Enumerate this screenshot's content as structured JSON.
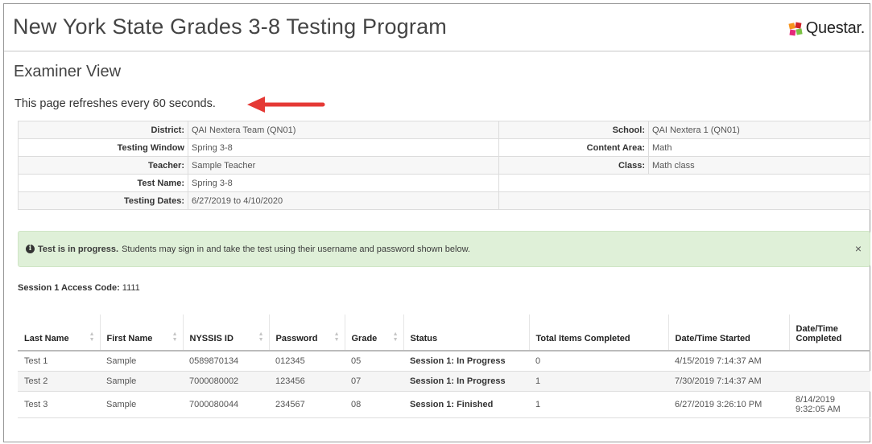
{
  "header": {
    "title": "New York State Grades 3-8 Testing Program",
    "logo_text": "Questar."
  },
  "page": {
    "subtitle": "Examiner View",
    "refresh_notice": "This page refreshes every 60 seconds."
  },
  "info": {
    "district_label": "District:",
    "district": "QAI Nextera Team (QN01)",
    "school_label": "School:",
    "school": "QAI Nextera 1 (QN01)",
    "window_label": "Testing Window",
    "window": "Spring 3-8",
    "content_label": "Content Area:",
    "content": "Math",
    "teacher_label": "Teacher:",
    "teacher": "Sample Teacher",
    "class_label": "Class:",
    "class": "Math class",
    "testname_label": "Test Name:",
    "testname": "Spring 3-8",
    "dates_label": "Testing Dates:",
    "dates": "6/27/2019 to 4/10/2020"
  },
  "alert": {
    "bold": "Test is in progress.",
    "text": "Students may sign in and take the test using their username and password shown below.",
    "close": "×"
  },
  "access": {
    "label": "Session 1 Access Code:",
    "code": "1111"
  },
  "roster": {
    "headers": {
      "last_name": "Last Name",
      "first_name": "First Name",
      "nyssis": "NYSSIS ID",
      "password": "Password",
      "grade": "Grade",
      "status": "Status",
      "items": "Total Items Completed",
      "started": "Date/Time Started",
      "completed_1": "Date/Time",
      "completed_2": "Completed"
    },
    "rows": [
      {
        "last": "Test 1",
        "first": "Sample",
        "id": "0589870134",
        "password": "012345",
        "grade": "05",
        "status": "Session 1: In Progress",
        "items": "0",
        "started": "4/15/2019 7:14:37 AM",
        "completed_date": "",
        "completed_time": ""
      },
      {
        "last": "Test 2",
        "first": "Sample",
        "id": "7000080002",
        "password": "123456",
        "grade": "07",
        "status": "Session 1: In Progress",
        "items": "1",
        "started": "7/30/2019 7:14:37 AM",
        "completed_date": "",
        "completed_time": ""
      },
      {
        "last": "Test 3",
        "first": "Sample",
        "id": "7000080044",
        "password": "234567",
        "grade": "08",
        "status": "Session 1: Finished",
        "items": "1",
        "started": "6/27/2019 3:26:10 PM",
        "completed_date": "8/14/2019",
        "completed_time": "9:32:05 AM"
      }
    ]
  },
  "annotation": {
    "arrow_color": "#e53935"
  }
}
